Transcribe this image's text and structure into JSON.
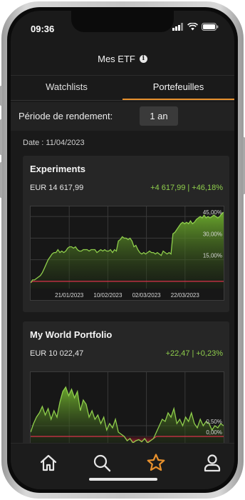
{
  "status_bar": {
    "time": "09:36"
  },
  "header": {
    "title": "Mes ETF",
    "info_icon": "info-icon"
  },
  "tabs": [
    {
      "label": "Watchlists",
      "active": false
    },
    {
      "label": "Portefeuilles",
      "active": true
    }
  ],
  "period": {
    "label": "Période de rendement:",
    "value": "1 an"
  },
  "date_label": "Date : 11/04/2023",
  "colors": {
    "accent": "#e8912d",
    "positive": "#8fce4c",
    "negative": "#d9334a",
    "background": "#1a1a1a"
  },
  "portfolios": [
    {
      "name": "Experiments",
      "value": "EUR 14 617,99",
      "change_abs": "+4 617,99",
      "change_pct": "+46,18%",
      "chart_data": {
        "type": "area",
        "x_tick_labels": [
          "21/01/2023",
          "10/02/2023",
          "02/03/2023",
          "22/03/2023"
        ],
        "y_tick_labels": [
          "45,00%",
          "30,00%",
          "15,00%"
        ],
        "y_ticks": [
          45,
          30,
          15
        ],
        "ylim": [
          -5,
          52
        ],
        "grid": true,
        "values": [
          -1,
          1,
          1,
          2,
          3,
          4,
          6,
          9,
          12,
          15,
          17,
          19,
          20,
          20,
          22,
          20,
          21,
          20,
          21,
          23,
          24,
          24,
          23,
          24,
          22,
          21,
          21,
          22,
          22,
          22,
          21,
          22,
          22,
          22,
          20,
          21,
          22,
          21,
          22,
          21,
          21,
          22,
          20,
          22,
          21,
          28,
          29,
          31,
          30,
          30,
          29,
          30,
          28,
          24,
          25,
          22,
          20,
          19,
          20,
          19,
          20,
          21,
          20,
          20,
          19,
          20,
          19,
          18,
          21,
          20,
          19,
          20,
          19,
          33,
          34,
          36,
          38,
          40,
          41,
          40,
          41,
          40,
          42,
          40,
          41,
          43,
          44,
          45,
          44,
          46,
          44,
          45,
          44,
          45,
          46,
          45,
          44,
          45,
          47,
          48
        ],
        "series": [
          {
            "color": "#8fce4c"
          }
        ]
      }
    },
    {
      "name": "My World Portfolio",
      "value": "EUR 10 022,47",
      "change_abs": "+22,47",
      "change_pct": "+0,23%",
      "chart_data": {
        "type": "area",
        "y_tick_labels": [
          "0,50%",
          "0,00%"
        ],
        "y_ticks": [
          0.5,
          0
        ],
        "ylim": [
          -0.6,
          3.0
        ],
        "grid": true,
        "values": [
          0.2,
          0.6,
          0.9,
          1.1,
          1.4,
          1.0,
          1.3,
          0.8,
          1.2,
          0.9,
          1.6,
          2.1,
          2.3,
          1.9,
          2.2,
          1.8,
          2.1,
          1.2,
          1.7,
          1.5,
          0.9,
          1.2,
          0.8,
          1.0,
          0.6,
          0.9,
          0.3,
          0.6,
          0.4,
          0.8,
          0.2,
          0.1,
          0.0,
          -0.2,
          -0.1,
          -0.3,
          -0.2,
          -0.15,
          -0.25,
          -0.1,
          -0.3,
          -0.2,
          -0.1,
          0.2,
          0.5,
          0.8,
          0.7,
          1.1,
          0.9,
          1.3,
          0.6,
          0.8,
          0.5,
          0.9,
          0.7,
          1.1,
          0.6,
          0.4,
          0.8,
          0.5,
          0.7,
          0.6,
          0.3,
          0.5,
          0.4,
          0.6,
          0.5
        ],
        "series": [
          {
            "color": "#8fce4c"
          }
        ]
      }
    }
  ],
  "bottom_nav": [
    {
      "icon": "home-icon",
      "active": false
    },
    {
      "icon": "search-icon",
      "active": false
    },
    {
      "icon": "star-icon",
      "active": true
    },
    {
      "icon": "user-icon",
      "active": false
    }
  ]
}
